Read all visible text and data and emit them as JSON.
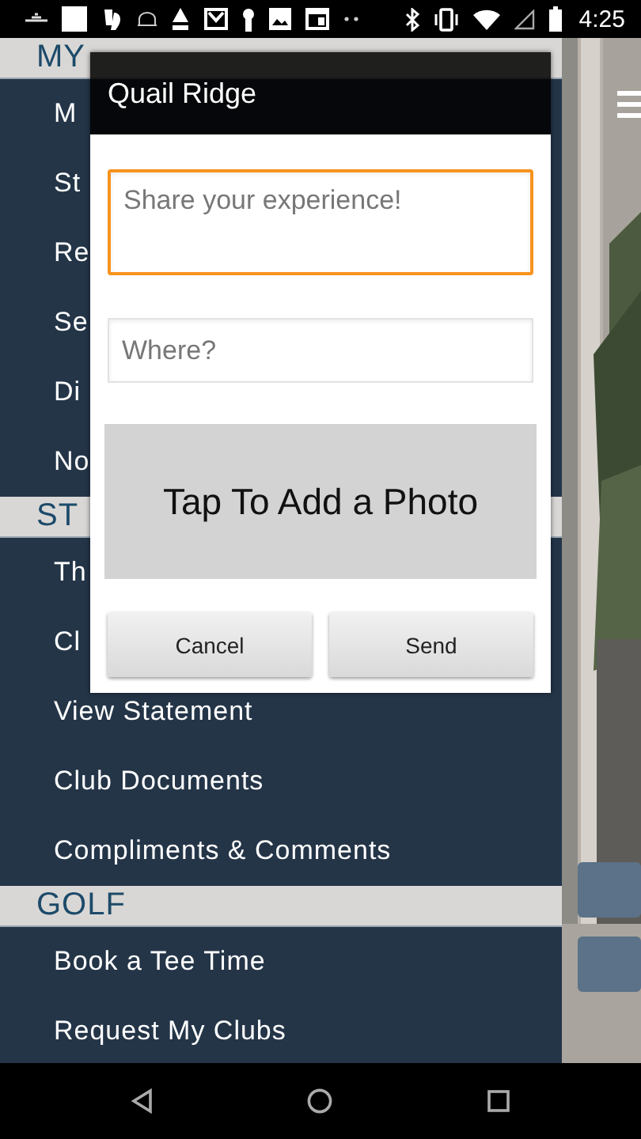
{
  "status_bar": {
    "time": "4:25"
  },
  "menu": {
    "sections": [
      {
        "title": "MY",
        "items": [
          "M",
          "St",
          "Re",
          "Se",
          "Di",
          "No"
        ]
      },
      {
        "title": "ST",
        "items": [
          "Th",
          "Cl",
          "View Statement",
          "Club Documents",
          "Compliments & Comments"
        ]
      },
      {
        "title": "GOLF",
        "items": [
          "Book a Tee Time",
          "Request My Clubs"
        ]
      }
    ]
  },
  "dialog": {
    "title": "Quail Ridge",
    "fields": [
      {
        "kind": "multiline",
        "placeholder": "Share your experience!",
        "focused": true
      },
      {
        "kind": "single",
        "placeholder": "Where?",
        "focused": false
      }
    ],
    "photo_button": "Tap To Add a Photo",
    "buttons": [
      "Cancel",
      "Send"
    ]
  }
}
